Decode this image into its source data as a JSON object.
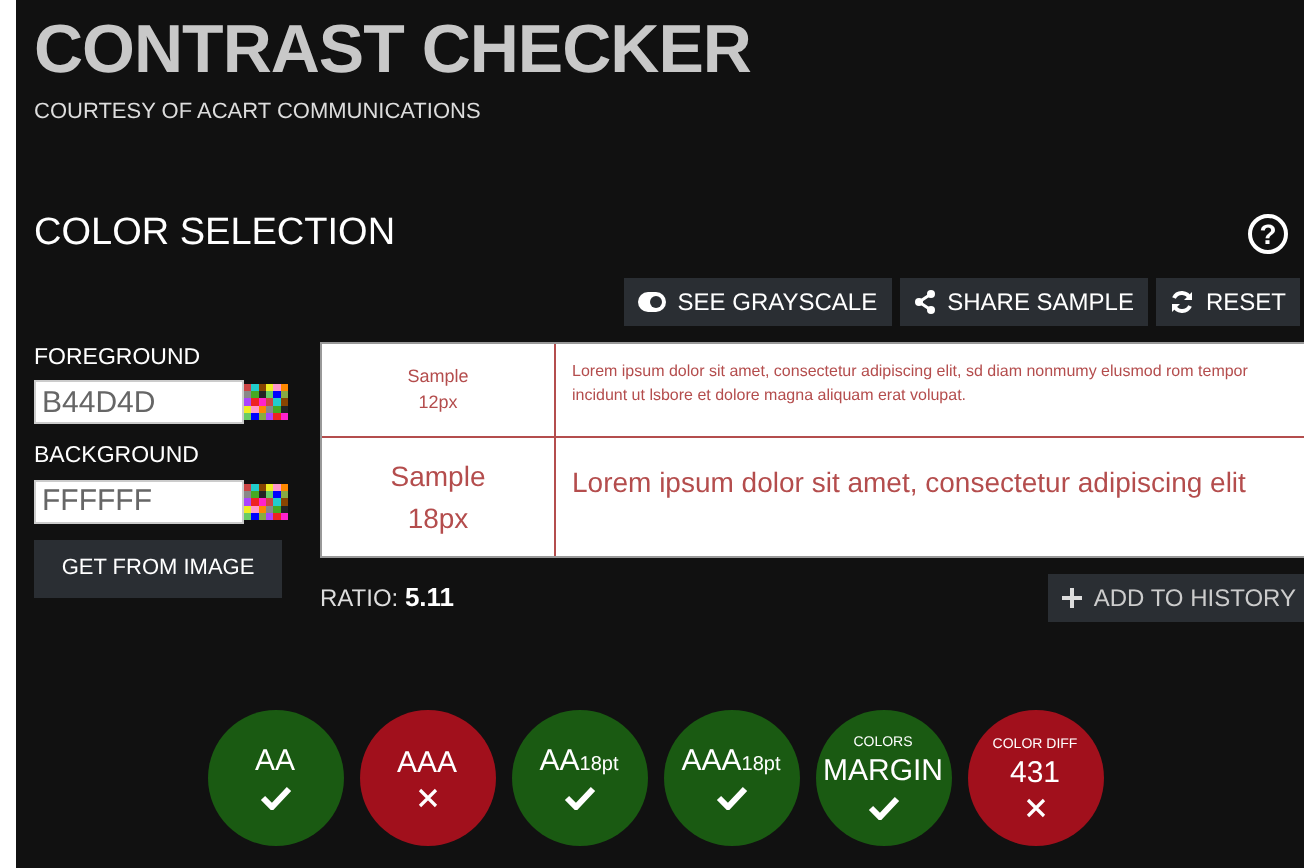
{
  "header": {
    "title": "CONTRAST CHECKER",
    "subtitle": "COURTESY OF ACART COMMUNICATIONS"
  },
  "section": {
    "title": "COLOR SELECTION",
    "help": "?"
  },
  "toolbar": [
    {
      "kind": "grayscale",
      "label": "SEE GRAYSCALE"
    },
    {
      "kind": "share",
      "label": "SHARE SAMPLE"
    },
    {
      "kind": "reset",
      "label": "RESET"
    }
  ],
  "fields": [
    {
      "label": "FOREGROUND",
      "value": "B44D4D"
    },
    {
      "label": "BACKGROUND",
      "value": "FFFFFF"
    }
  ],
  "get_from_image": "GET FROM IMAGE",
  "preview": [
    {
      "size_label": "Sample\n12px",
      "text": "Lorem ipsum dolor sit amet, consectetur adipiscing elit, sd diam nonmumy elusmod rom tempor incidunt ut lsbore et dolore magna aliquam erat volupat."
    },
    {
      "size_label": "Sample\n18px",
      "text": "Lorem ipsum dolor sit amet, consectetur adipiscing elit"
    }
  ],
  "ratio": {
    "label": "RATIO:",
    "value": "5.11"
  },
  "add_history": "ADD TO HISTORY",
  "results": [
    {
      "label": "AA",
      "pass": true
    },
    {
      "label": "AAA",
      "pass": false
    },
    {
      "label": "AA$_{18pt}$",
      "pass": true
    },
    {
      "label": "AAA$_{18pt}$",
      "pass": true
    },
    {
      "top": "COLORS",
      "label": "MARGIN",
      "pass": true
    },
    {
      "top": "COLOR DIFF",
      "label": "431",
      "pass": false
    }
  ]
}
